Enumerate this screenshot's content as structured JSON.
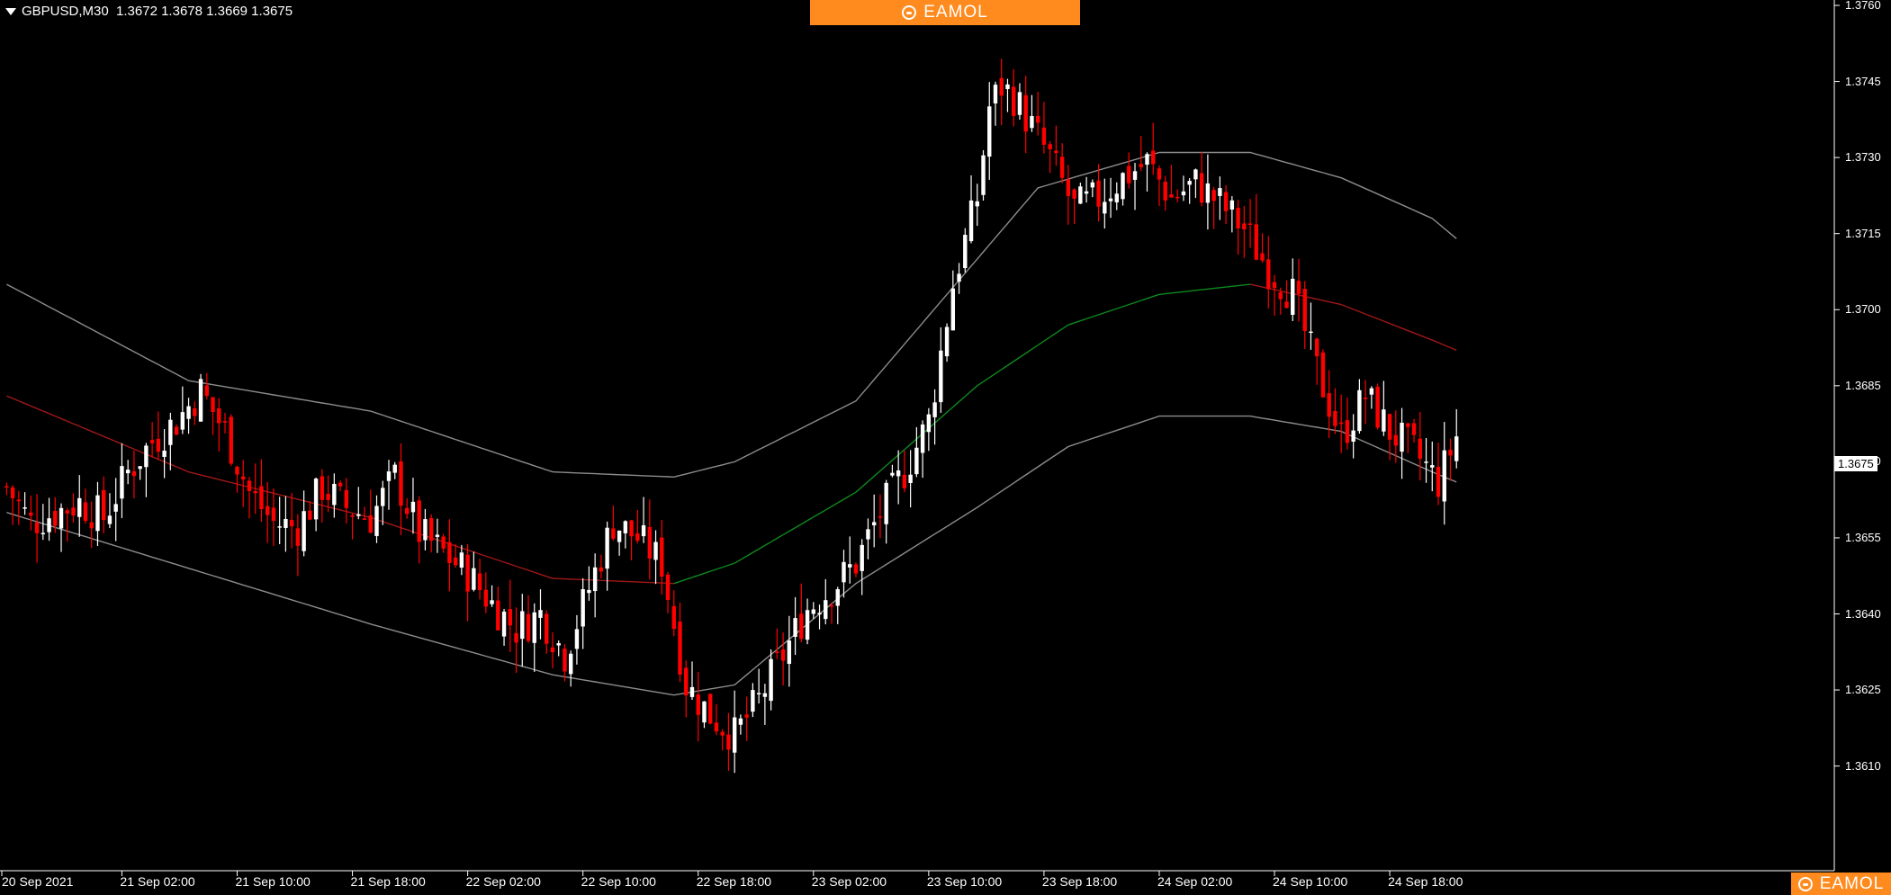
{
  "header": {
    "symbol": "GBPUSD,M30",
    "ohlc": "1.3672 1.3678 1.3669 1.3675"
  },
  "brand": {
    "name": "EAMOL"
  },
  "colors": {
    "background": "#000000",
    "bull": "#ffffff",
    "bear": "#ff0000",
    "band": "#8c8c8c",
    "mid_up": "#0d8a1e",
    "mid_down": "#a01818",
    "brand": "#ff8a1e"
  },
  "chart_data": {
    "type": "candlestick",
    "symbol": "GBPUSD",
    "timeframe": "M30",
    "current_price": "1.3675",
    "ylim": [
      1.36,
      1.376
    ],
    "y_ticks": [
      "1.3760",
      "1.3745",
      "1.3730",
      "1.3715",
      "1.3700",
      "1.3685",
      "1.3670",
      "1.3655",
      "1.3640",
      "1.3625",
      "1.3610"
    ],
    "x_ticks": [
      "20 Sep 2021",
      "21 Sep 02:00",
      "21 Sep 10:00",
      "21 Sep 18:00",
      "22 Sep 02:00",
      "22 Sep 10:00",
      "22 Sep 18:00",
      "23 Sep 02:00",
      "23 Sep 10:00",
      "23 Sep 18:00",
      "24 Sep 02:00",
      "24 Sep 10:00",
      "24 Sep 18:00"
    ],
    "close_path": [
      [
        0,
        1.3665
      ],
      [
        4,
        1.3658
      ],
      [
        8,
        1.366
      ],
      [
        12,
        1.3662
      ],
      [
        16,
        1.3659
      ],
      [
        20,
        1.3668
      ],
      [
        24,
        1.3674
      ],
      [
        28,
        1.3678
      ],
      [
        32,
        1.3684
      ],
      [
        36,
        1.3676
      ],
      [
        40,
        1.3664
      ],
      [
        44,
        1.3658
      ],
      [
        48,
        1.3657
      ],
      [
        52,
        1.3665
      ],
      [
        56,
        1.3661
      ],
      [
        60,
        1.3659
      ],
      [
        64,
        1.3667
      ],
      [
        68,
        1.3656
      ],
      [
        72,
        1.3652
      ],
      [
        76,
        1.3648
      ],
      [
        80,
        1.3642
      ],
      [
        84,
        1.3637
      ],
      [
        88,
        1.364
      ],
      [
        92,
        1.3632
      ],
      [
        96,
        1.3645
      ],
      [
        100,
        1.3658
      ],
      [
        104,
        1.3655
      ],
      [
        108,
        1.365
      ],
      [
        112,
        1.3626
      ],
      [
        116,
        1.362
      ],
      [
        120,
        1.3616
      ],
      [
        124,
        1.3623
      ],
      [
        128,
        1.3632
      ],
      [
        132,
        1.3641
      ],
      [
        136,
        1.3645
      ],
      [
        140,
        1.365
      ],
      [
        144,
        1.366
      ],
      [
        148,
        1.3668
      ],
      [
        152,
        1.3678
      ],
      [
        156,
        1.3705
      ],
      [
        160,
        1.3722
      ],
      [
        162,
        1.374
      ],
      [
        164,
        1.3744
      ],
      [
        166,
        1.3742
      ],
      [
        168,
        1.3738
      ],
      [
        172,
        1.373
      ],
      [
        176,
        1.372
      ],
      [
        180,
        1.3722
      ],
      [
        184,
        1.3726
      ],
      [
        188,
        1.3729
      ],
      [
        192,
        1.3722
      ],
      [
        196,
        1.3725
      ],
      [
        200,
        1.3721
      ],
      [
        204,
        1.3716
      ],
      [
        208,
        1.3708
      ],
      [
        212,
        1.3703
      ],
      [
        216,
        1.3688
      ],
      [
        220,
        1.3675
      ],
      [
        224,
        1.3683
      ],
      [
        228,
        1.3676
      ],
      [
        232,
        1.3672
      ],
      [
        236,
        1.3666
      ],
      [
        239,
        1.3675
      ]
    ],
    "bands": {
      "upper": [
        [
          0,
          1.3705
        ],
        [
          30,
          1.3686
        ],
        [
          60,
          1.368
        ],
        [
          90,
          1.3668
        ],
        [
          110,
          1.3667
        ],
        [
          120,
          1.367
        ],
        [
          140,
          1.3682
        ],
        [
          160,
          1.371
        ],
        [
          170,
          1.3724
        ],
        [
          190,
          1.3731
        ],
        [
          205,
          1.3731
        ],
        [
          220,
          1.3726
        ],
        [
          235,
          1.3718
        ],
        [
          239,
          1.3714
        ]
      ],
      "middle": [
        [
          0,
          1.3683
        ],
        [
          30,
          1.3668
        ],
        [
          60,
          1.3659
        ],
        [
          90,
          1.3647
        ],
        [
          110,
          1.3646
        ],
        [
          120,
          1.365
        ],
        [
          140,
          1.3664
        ],
        [
          160,
          1.3685
        ],
        [
          175,
          1.3697
        ],
        [
          190,
          1.3703
        ],
        [
          205,
          1.3705
        ],
        [
          220,
          1.3701
        ],
        [
          235,
          1.3694
        ],
        [
          239,
          1.3692
        ]
      ],
      "lower": [
        [
          0,
          1.366
        ],
        [
          30,
          1.3649
        ],
        [
          60,
          1.3638
        ],
        [
          90,
          1.3628
        ],
        [
          110,
          1.3624
        ],
        [
          120,
          1.3626
        ],
        [
          140,
          1.3646
        ],
        [
          160,
          1.3661
        ],
        [
          175,
          1.3673
        ],
        [
          190,
          1.3679
        ],
        [
          205,
          1.3679
        ],
        [
          220,
          1.3676
        ],
        [
          235,
          1.3668
        ],
        [
          239,
          1.3666
        ]
      ]
    },
    "grid": false
  }
}
